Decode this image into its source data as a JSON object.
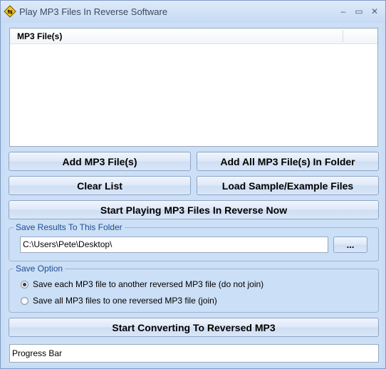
{
  "window": {
    "title": "Play MP3 Files In Reverse Software",
    "minimize_glyph": "–",
    "maximize_glyph": "▭",
    "close_glyph": "✕"
  },
  "file_list": {
    "column_header": "MP3 File(s)",
    "rows": []
  },
  "buttons": {
    "add_files": "Add MP3 File(s)",
    "add_folder": "Add All MP3 File(s) In Folder",
    "clear_list": "Clear List",
    "load_sample": "Load Sample/Example Files",
    "start_playing": "Start Playing MP3 Files In Reverse Now",
    "browse": "...",
    "start_converting": "Start Converting To Reversed MP3"
  },
  "save_results": {
    "legend": "Save Results To This Folder",
    "folder_path": "C:\\Users\\Pete\\Desktop\\"
  },
  "save_option": {
    "legend": "Save Option",
    "options": [
      {
        "label": "Save each MP3 file to another reversed MP3 file (do not join)",
        "checked": true
      },
      {
        "label": "Save all MP3 files to one reversed MP3 file (join)",
        "checked": false
      }
    ]
  },
  "progress": {
    "label": "Progress Bar"
  },
  "colors": {
    "window_bg": "#cbdff6",
    "legend_text": "#1f4d8f"
  }
}
